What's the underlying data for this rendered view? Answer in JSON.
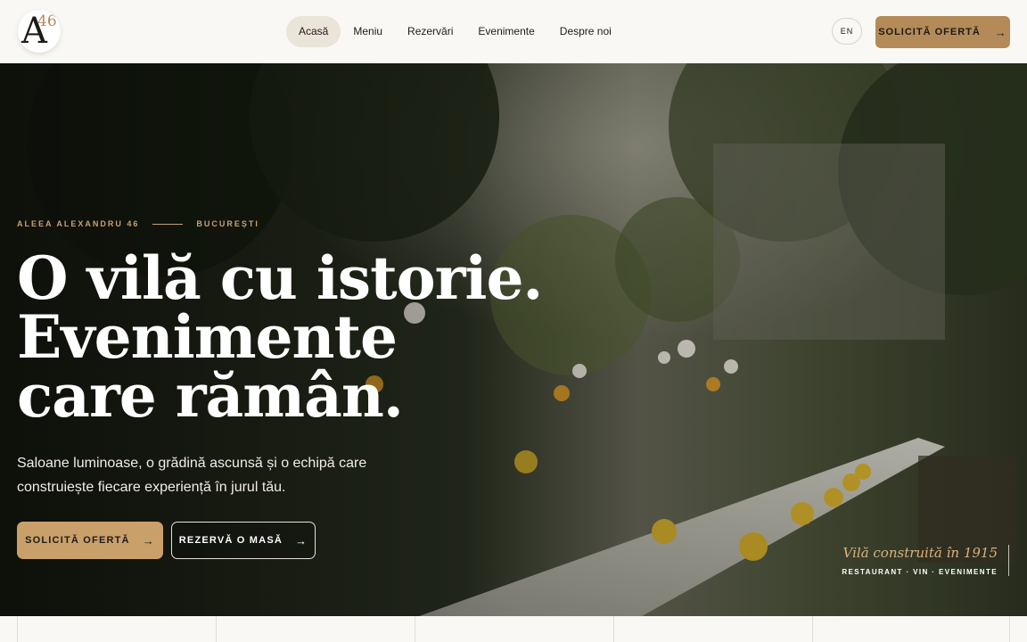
{
  "header": {
    "logo": {
      "letter": "A",
      "number": "46"
    },
    "nav": [
      {
        "label": "Acasă",
        "active": true
      },
      {
        "label": "Meniu",
        "active": false
      },
      {
        "label": "Rezervări",
        "active": false
      },
      {
        "label": "Evenimente",
        "active": false
      },
      {
        "label": "Despre noi",
        "active": false
      }
    ],
    "lang": "EN",
    "cta": {
      "label": "SOLICITĂ OFERTĂ",
      "icon": "arrow-right-icon"
    }
  },
  "hero": {
    "kicker_left": "ALEEA ALEXANDRU 46",
    "kicker_right": "BUCUREȘTI",
    "headline": [
      "O vilă cu istorie.",
      "Evenimente",
      "care rămân."
    ],
    "subtitle": "Saloane luminoase, o grădină ascunsă și o echipă care construiește fiecare experiență în jurul tău.",
    "primary_button": "SOLICITĂ OFERTĂ",
    "secondary_button": "REZERVĂ O MASĂ",
    "badge_title": "Vilă construită în 1915",
    "badge_subtitle": "RESTAURANT · VIN · EVENIMENTE"
  },
  "colors": {
    "accent": "#b38a58",
    "accent_light": "#c9a06a",
    "background": "#faf8f5",
    "text": "#1d1b18"
  }
}
